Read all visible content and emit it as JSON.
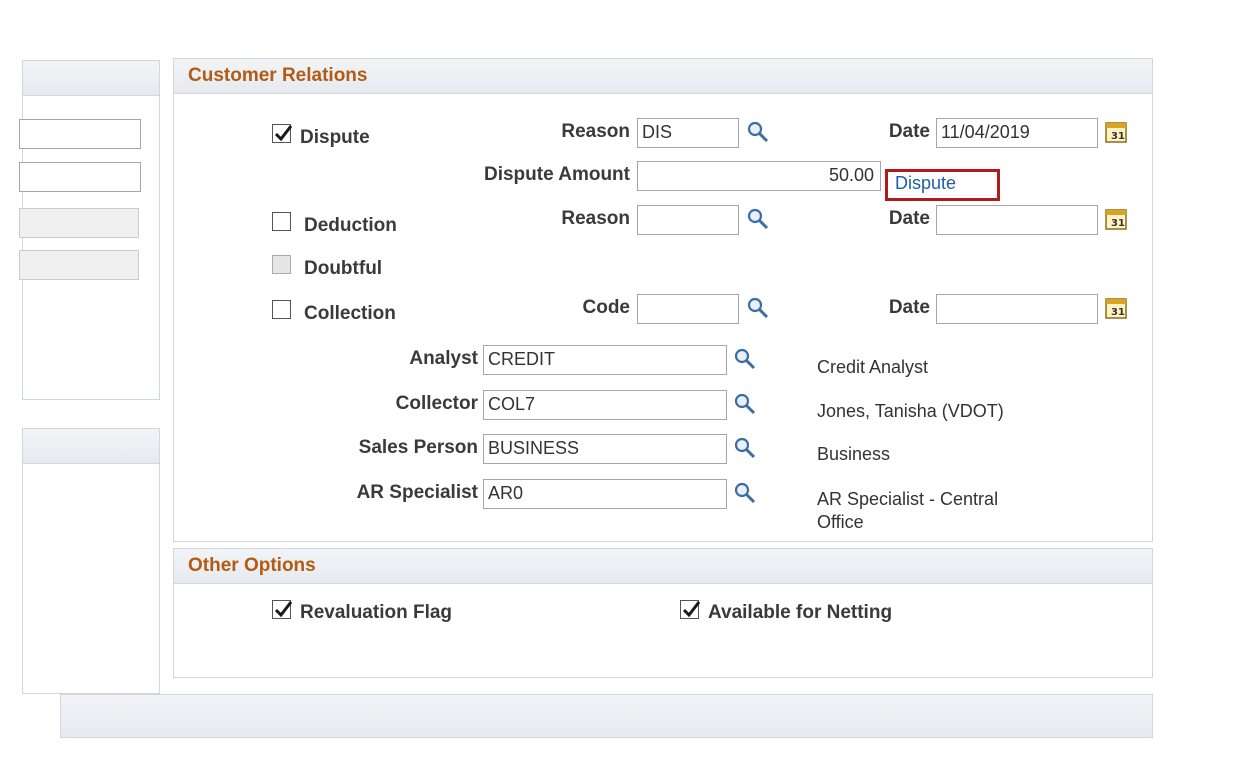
{
  "customer_relations": {
    "title": "Customer Relations",
    "dispute": {
      "label": "Dispute",
      "checked": true,
      "reason_label": "Reason",
      "reason_value": "DIS",
      "date_label": "Date",
      "date_value": "11/04/2019"
    },
    "dispute_amount": {
      "label": "Dispute Amount",
      "value": "50.00",
      "link": "Dispute"
    },
    "deduction": {
      "label": "Deduction",
      "checked": false,
      "reason_label": "Reason",
      "reason_value": "",
      "date_label": "Date",
      "date_value": ""
    },
    "doubtful": {
      "label": "Doubtful",
      "checked": false,
      "disabled": true
    },
    "collection": {
      "label": "Collection",
      "checked": false,
      "code_label": "Code",
      "code_value": "",
      "date_label": "Date",
      "date_value": ""
    },
    "analyst": {
      "label": "Analyst",
      "value": "CREDIT",
      "description": "Credit Analyst"
    },
    "collector": {
      "label": "Collector",
      "value": "COL7",
      "description": "Jones, Tanisha (VDOT)"
    },
    "sales_person": {
      "label": "Sales Person",
      "value": "BUSINESS",
      "description": "Business"
    },
    "ar_specialist": {
      "label": "AR Specialist",
      "value": "AR0",
      "description_line1": "AR Specialist - Central",
      "description_line2": "Office"
    }
  },
  "other_options": {
    "title": "Other Options",
    "revaluation_flag": {
      "label": "Revaluation Flag",
      "checked": true
    },
    "available_for_netting": {
      "label": "Available for Netting",
      "checked": true
    }
  },
  "icons": {
    "lookup": "magnifier-icon",
    "calendar": "calendar-icon",
    "checkmark": "checkmark-icon"
  },
  "colors": {
    "section_title": "#b35b12",
    "link": "#1c5fa8",
    "highlight": "#b11a1a"
  }
}
